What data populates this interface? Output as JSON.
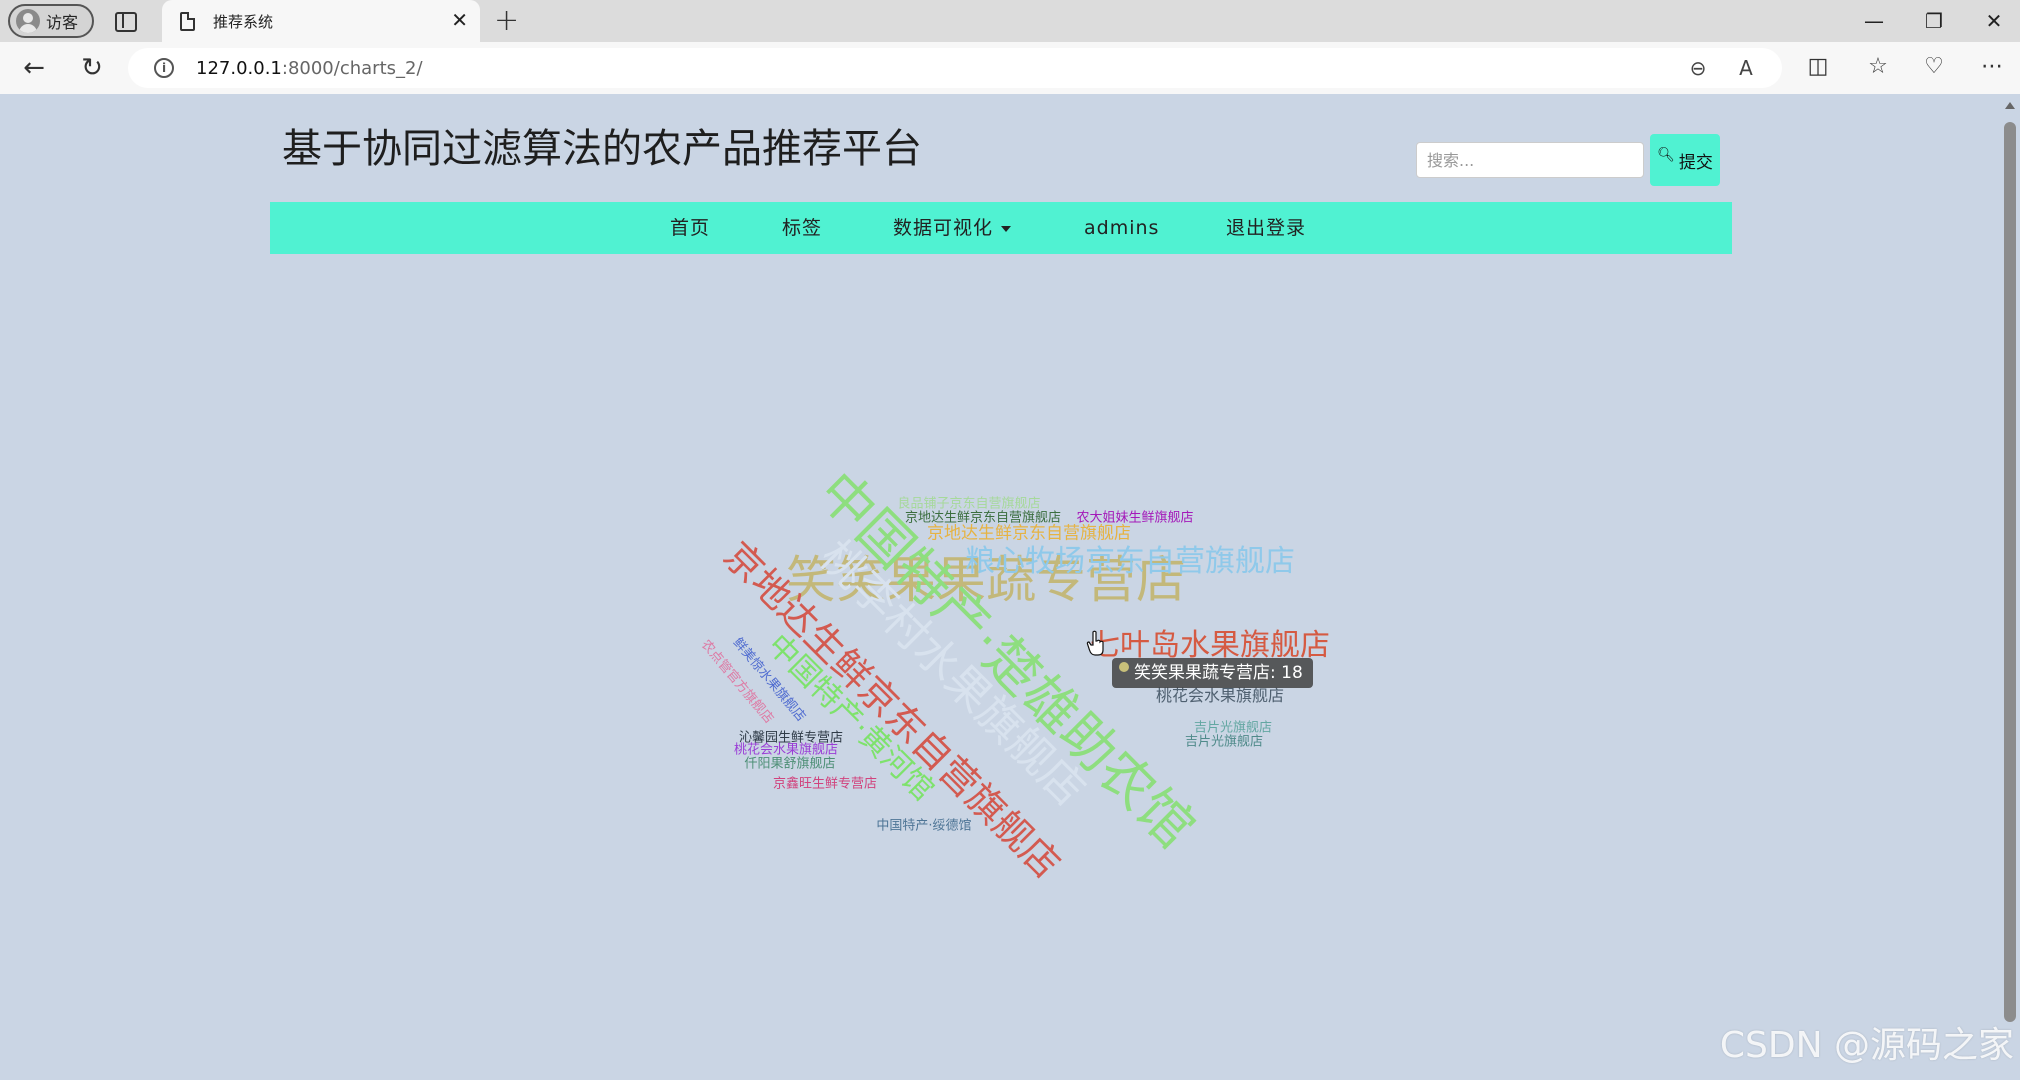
{
  "browser": {
    "profile_label": "访客",
    "tab_title": "推荐系统",
    "url_host": "127.0.0.1",
    "url_rest": ":8000/charts_2/"
  },
  "site": {
    "title": "基于协同过滤算法的农产品推荐平台",
    "search_placeholder": "搜索...",
    "submit_label": "提交"
  },
  "nav": {
    "items": [
      {
        "label": "首页"
      },
      {
        "label": "标签"
      },
      {
        "label": "数据可视化"
      },
      {
        "label": "admins"
      },
      {
        "label": "退出登录"
      }
    ]
  },
  "chart_data": {
    "type": "wordcloud",
    "words": [
      {
        "text": "笑笑果果蔬专营店",
        "value": 18,
        "color": "#c3b87a"
      },
      {
        "text": "中国特产·楚雄助农馆",
        "value": 18,
        "color": "#8ede7f"
      },
      {
        "text": "京地达生鲜京东自营旗舰店",
        "value": 14,
        "color": "#d35a50"
      },
      {
        "text": "桃李村水果旗舰店",
        "value": 14,
        "color": "#d8e2ee"
      },
      {
        "text": "七叶岛水果旗舰店",
        "value": 10,
        "color": "#d55a42"
      },
      {
        "text": "粮心牧场京东自营旗舰店",
        "value": 10,
        "color": "#8fc9ea"
      },
      {
        "text": "中国特产·黄河馆",
        "value": 10,
        "color": "#7ee26c"
      },
      {
        "text": "京地达生鲜京东自营旗舰店",
        "value": 5,
        "color": "#e6b343"
      },
      {
        "text": "良品铺子京东自营旗舰店",
        "value": 4,
        "color": "#a6d99a"
      },
      {
        "text": "京地达生鲜京东自营旗舰店",
        "value": 4,
        "color": "#3b6e3f"
      },
      {
        "text": "农大姐妹生鲜旗舰店",
        "value": 4,
        "color": "#a419b9"
      },
      {
        "text": "桃花会水果旗舰店",
        "value": 5,
        "color": "#4f6070"
      },
      {
        "text": "中国特产·绥德馆",
        "value": 4,
        "color": "#4e7596"
      },
      {
        "text": "沁馨园生鲜专营店",
        "value": 4,
        "color": "#2f3b47"
      },
      {
        "text": "桃花会水果旗舰店",
        "value": 4,
        "color": "#9a3ed6"
      },
      {
        "text": "仟阳果舒旗舰店",
        "value": 4,
        "color": "#4d8f76"
      },
      {
        "text": "京鑫旺生鲜专营店",
        "value": 4,
        "color": "#d1437d"
      },
      {
        "text": "鲜美惊水果旗舰店",
        "value": 4,
        "color": "#4f6bd0"
      },
      {
        "text": "农点管官方旗舰店",
        "value": 4,
        "color": "#de7aa4"
      },
      {
        "text": "吉片光旗舰店",
        "value": 4,
        "color": "#63a7a2"
      },
      {
        "text": "吉片光旗舰店",
        "value": 4,
        "color": "#4f8a8a"
      }
    ],
    "tooltip": {
      "label": "笑笑果果蔬专营店",
      "value": 18
    }
  },
  "watermark": "CSDN @源码之家"
}
